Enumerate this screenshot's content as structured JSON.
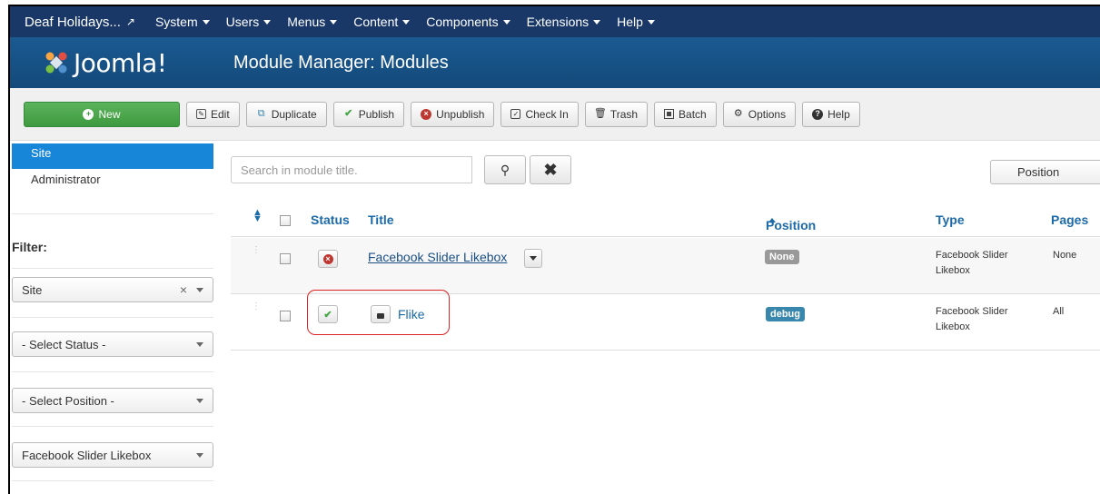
{
  "topnav": {
    "site": "Deaf Holidays...",
    "menus": [
      "System",
      "Users",
      "Menus",
      "Content",
      "Components",
      "Extensions",
      "Help"
    ]
  },
  "header": {
    "logo": "Joomla!",
    "title": "Module Manager: Modules"
  },
  "toolbar": {
    "new": "New",
    "edit": "Edit",
    "duplicate": "Duplicate",
    "publish": "Publish",
    "unpublish": "Unpublish",
    "checkin": "Check In",
    "trash": "Trash",
    "batch": "Batch",
    "options": "Options",
    "help": "Help"
  },
  "sidebar": {
    "site": "Site",
    "administrator": "Administrator",
    "filter_label": "Filter:",
    "filters": [
      "Site",
      "- Select Status -",
      "- Select Position -",
      "Facebook Slider Likebox"
    ]
  },
  "search": {
    "placeholder": "Search in module title.",
    "position_select": "Position"
  },
  "table": {
    "headers": {
      "status": "Status",
      "title": "Title",
      "position": "Position",
      "type": "Type",
      "pages": "Pages"
    },
    "rows": [
      {
        "title": "Facebook Slider Likebox",
        "position": "None",
        "type_line1": "Facebook Slider",
        "type_line2": "Likebox",
        "pages": "None",
        "published": false
      },
      {
        "title": "Flike",
        "position": "debug",
        "type_line1": "Facebook Slider",
        "type_line2": "Likebox",
        "pages": "All",
        "published": true
      }
    ]
  },
  "colors": {
    "topnav": "#1a3867",
    "header": "#17568c",
    "accent": "#1786d9",
    "new_button": "#4ba64b",
    "link": "#1c6aa8",
    "highlight": "#dd2222"
  }
}
